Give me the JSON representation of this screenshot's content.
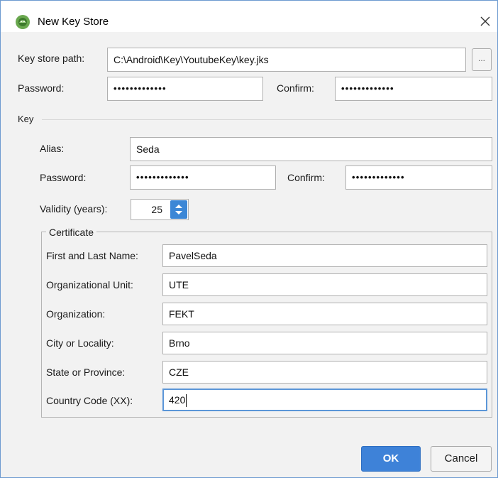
{
  "window": {
    "title": "New Key Store"
  },
  "keystore": {
    "path_label": "Key store path:",
    "path_value": "C:\\Android\\Key\\YoutubeKey\\key.jks",
    "browse_label": "...",
    "password_label": "Password:",
    "password_value": "•••••••••••••",
    "confirm_label": "Confirm:",
    "confirm_value": "•••••••••••••"
  },
  "key": {
    "section_label": "Key",
    "alias_label": "Alias:",
    "alias_value": "Seda",
    "password_label": "Password:",
    "password_value": "•••••••••••••",
    "confirm_label": "Confirm:",
    "confirm_value": "•••••••••••••",
    "validity_label": "Validity (years):",
    "validity_value": "25"
  },
  "certificate": {
    "section_label": "Certificate",
    "fields": [
      {
        "label": "First and Last Name:",
        "value": "PavelSeda"
      },
      {
        "label": "Organizational Unit:",
        "value": "UTE"
      },
      {
        "label": "Organization:",
        "value": "FEKT"
      },
      {
        "label": "City or Locality:",
        "value": "Brno"
      },
      {
        "label": "State or Province:",
        "value": "CZE"
      },
      {
        "label": "Country Code (XX):",
        "value": "420"
      }
    ]
  },
  "buttons": {
    "ok": "OK",
    "cancel": "Cancel"
  },
  "colors": {
    "accent": "#3e82d8",
    "focus_border": "#5b96d8",
    "dialog_bg": "#f2f2f2"
  }
}
